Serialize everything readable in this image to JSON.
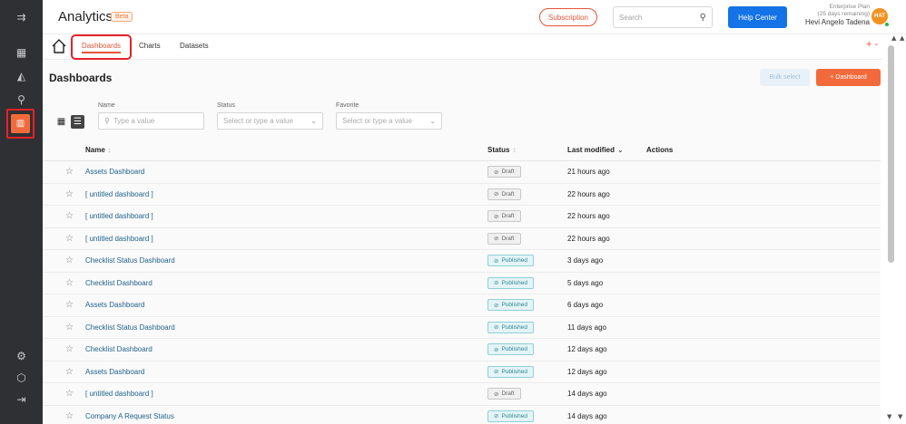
{
  "colors": {
    "accent": "#f26a3b",
    "primary_blue": "#1473e6",
    "link": "#20628e",
    "rail": "#2f3033",
    "highlight_border": "#e5222b"
  },
  "header": {
    "app_title": "Analytics",
    "beta": "Beta",
    "subscription": "Subscription",
    "search_placeholder": "Search",
    "help_center": "Help Center",
    "plan_line1": "Enterprise Plan",
    "plan_line2": "(25 days remaining)",
    "user_name": "Hevi Angelo Tadena",
    "avatar_initials": "HAT"
  },
  "rail": {
    "icons": [
      "menu-expand-icon",
      "dashboard-grid-icon",
      "map-icon",
      "hierarchy-icon",
      "analytics-icon",
      "settings-icon",
      "box-icon",
      "logout-icon"
    ],
    "active": "analytics-icon"
  },
  "subnav": {
    "tabs": [
      {
        "label": "Dashboards",
        "active": true
      },
      {
        "label": "Charts"
      },
      {
        "label": "Datasets"
      }
    ],
    "add": "+ -"
  },
  "main": {
    "title": "Dashboards",
    "bulk_select": "Bulk select",
    "add_dashboard": "+ Dashboard",
    "filters": {
      "name_label": "Name",
      "name_placeholder": "Type a value",
      "status_label": "Status",
      "status_placeholder": "Select or type a value",
      "favorite_label": "Favorite",
      "favorite_placeholder": "Select or type a value"
    }
  },
  "table": {
    "headers": {
      "name": "Name",
      "status": "Status",
      "modified": "Last modified",
      "actions": "Actions"
    },
    "rows": [
      {
        "name": "Assets Dashboard",
        "status": "Draft",
        "modified": "21 hours ago"
      },
      {
        "name": "[ untitled dashboard ]",
        "status": "Draft",
        "modified": "22 hours ago"
      },
      {
        "name": "[ untitled dashboard ]",
        "status": "Draft",
        "modified": "22 hours ago"
      },
      {
        "name": "[ untitled dashboard ]",
        "status": "Draft",
        "modified": "22 hours ago"
      },
      {
        "name": "Checklist Status Dashboard",
        "status": "Published",
        "modified": "3 days ago"
      },
      {
        "name": "Checklist Dashboard",
        "status": "Published",
        "modified": "5 days ago"
      },
      {
        "name": "Assets Dashboard",
        "status": "Published",
        "modified": "6 days ago"
      },
      {
        "name": "Checklist Status Dashboard",
        "status": "Published",
        "modified": "11 days ago"
      },
      {
        "name": "Checklist Dashboard",
        "status": "Published",
        "modified": "12 days ago"
      },
      {
        "name": "Assets Dashboard",
        "status": "Published",
        "modified": "12 days ago"
      },
      {
        "name": "[ untitled dashboard ]",
        "status": "Draft",
        "modified": "14 days ago"
      },
      {
        "name": "Company A Request Status",
        "status": "Published",
        "modified": "14 days ago"
      }
    ]
  }
}
